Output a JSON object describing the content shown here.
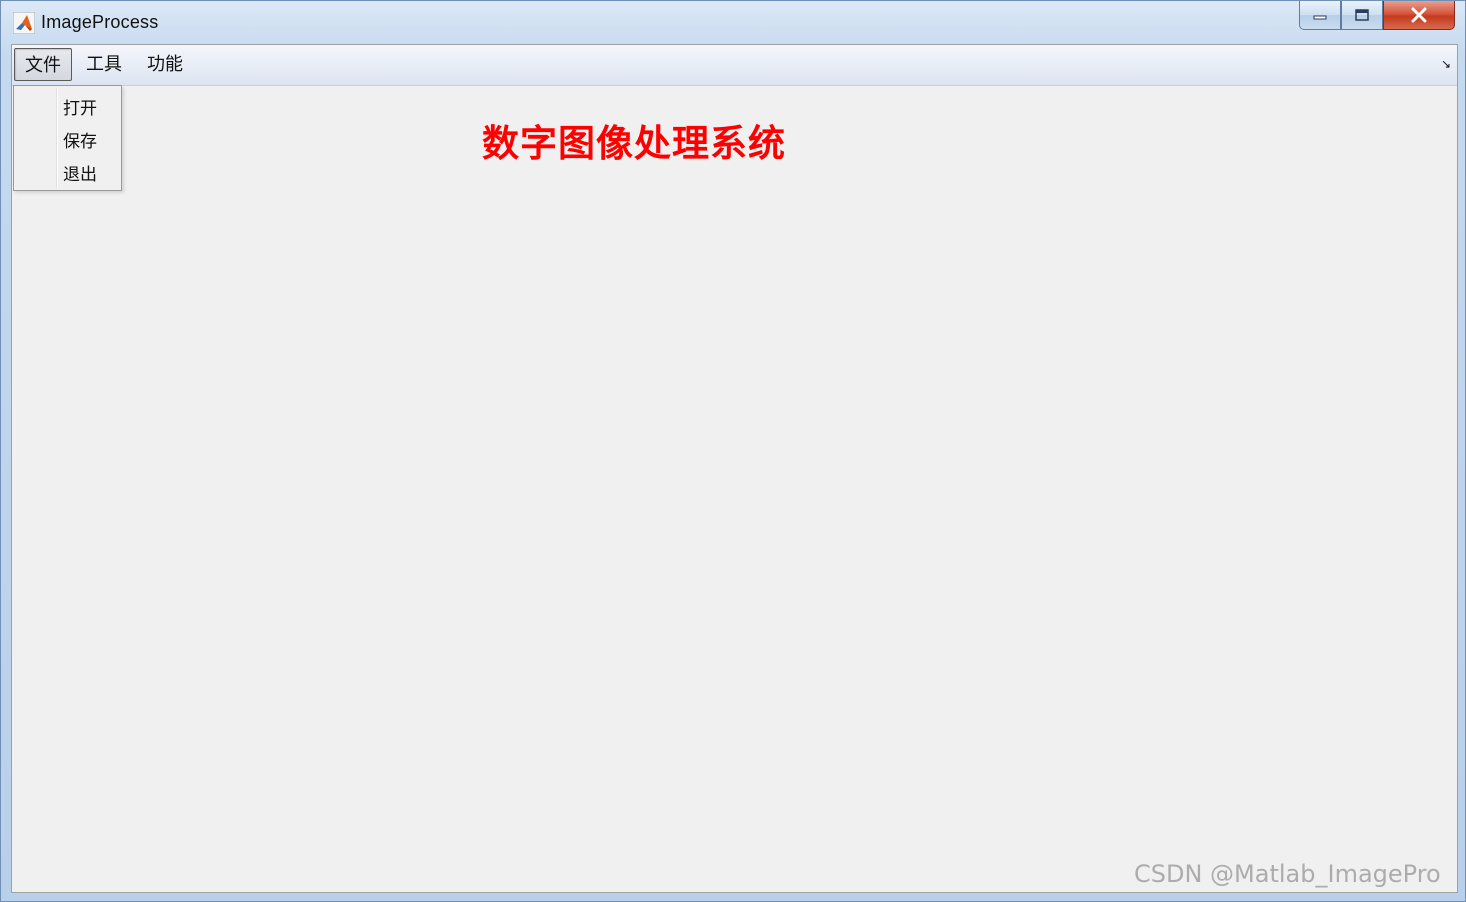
{
  "window": {
    "title": "ImageProcess"
  },
  "menubar": {
    "items": [
      {
        "label": "文件",
        "active": true
      },
      {
        "label": "工具",
        "active": false
      },
      {
        "label": "功能",
        "active": false
      }
    ],
    "corner_glyph": "↘"
  },
  "dropdown": {
    "items": [
      {
        "label": "打开"
      },
      {
        "label": "保存"
      },
      {
        "label": "退出"
      }
    ]
  },
  "main": {
    "heading": "数字图像处理系统",
    "heading_color": "#ff0000"
  },
  "watermark": "CSDN @Matlab_ImagePro",
  "icons": {
    "app": "matlab-logo-icon",
    "minimize": "minimize-icon",
    "maximize": "maximize-icon",
    "close": "close-icon"
  }
}
